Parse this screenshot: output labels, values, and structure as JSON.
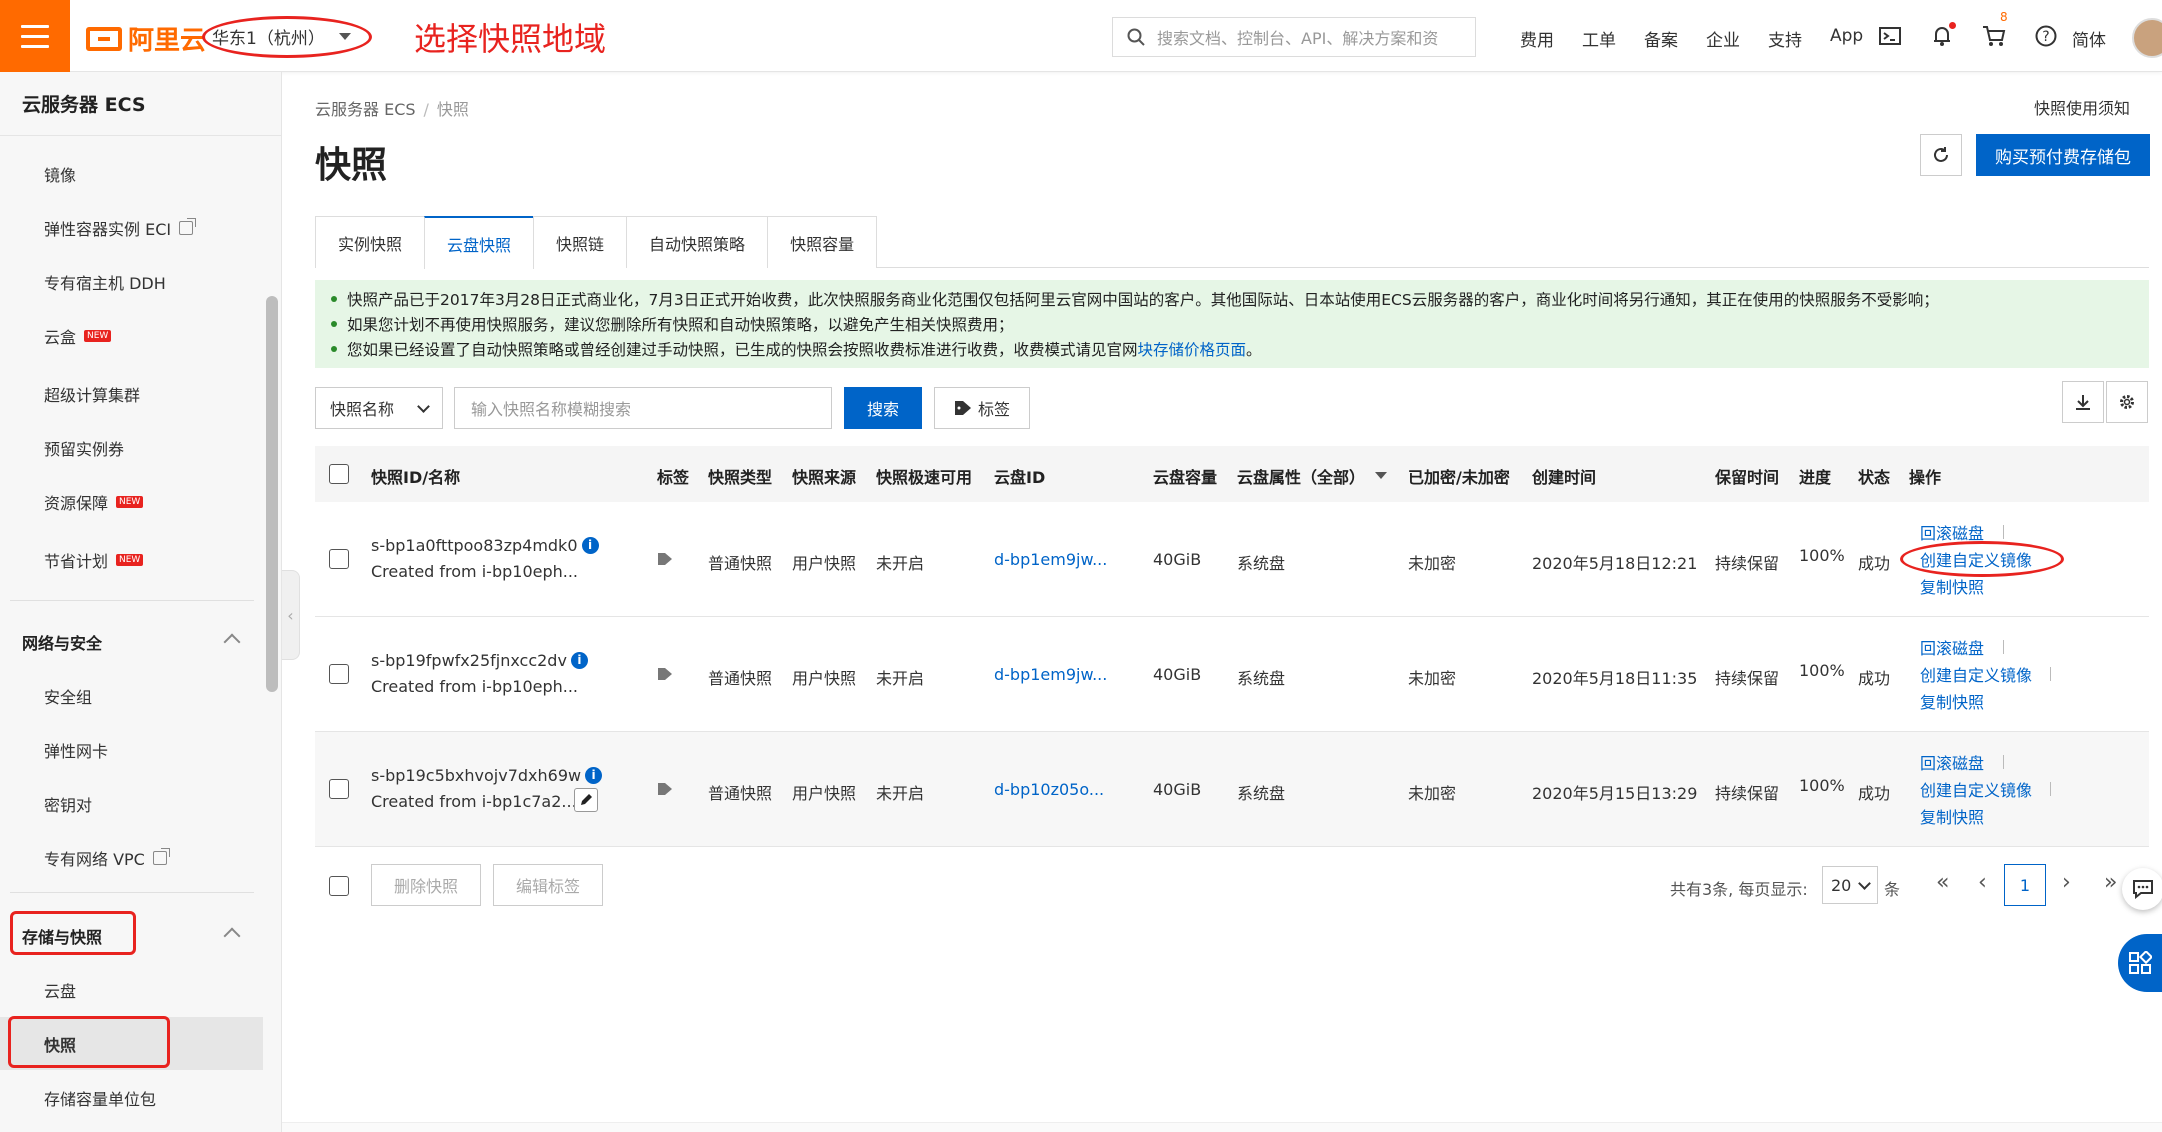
{
  "header": {
    "logo": "阿里云",
    "region": "华东1（杭州）",
    "annotation": "选择快照地域",
    "search_placeholder": "搜索文档、控制台、API、解决方案和资",
    "nav": [
      "费用",
      "工单",
      "备案",
      "企业",
      "支持",
      "App"
    ],
    "cart_count": "8",
    "lang": "简体"
  },
  "sidebar": {
    "title": "云服务器 ECS",
    "items_top": [
      {
        "label": "镜像"
      },
      {
        "label": "弹性容器实例 ECI"
      },
      {
        "label": "专有宿主机 DDH"
      },
      {
        "label": "云盒",
        "badge": "NEW"
      },
      {
        "label": "超级计算集群"
      },
      {
        "label": "预留实例券"
      },
      {
        "label": "资源保障",
        "badge": "NEW"
      },
      {
        "label": "节省计划",
        "badge": "NEW"
      }
    ],
    "group_network": "网络与安全",
    "items_network": [
      "安全组",
      "弹性网卡",
      "密钥对",
      "专有网络 VPC"
    ],
    "group_storage": "存储与快照",
    "items_storage": [
      "云盘",
      "快照",
      "存储容量单位包"
    ]
  },
  "main": {
    "breadcrumb": [
      "云服务器 ECS",
      "快照"
    ],
    "notice_link": "快照使用须知",
    "title": "快照",
    "buy_button": "购买预付费存储包",
    "tabs": [
      "实例快照",
      "云盘快照",
      "快照链",
      "自动快照策略",
      "快照容量"
    ],
    "active_tab": 1,
    "alerts": [
      "快照产品已于2017年3月28日正式商业化，7月3日正式开始收费，此次快照服务商业化范围仅包括阿里云官网中国站的客户。其他国际站、日本站使用ECS云服务器的客户，商业化时间将另行通知，其正在使用的快照服务不受影响；",
      "如果您计划不再使用快照服务，建议您删除所有快照和自动快照策略，以避免产生相关快照费用；",
      "您如果已经设置了自动快照策略或曾经创建过手动快照，已生成的快照会按照收费标准进行收费，收费模式请见官网"
    ],
    "alert_link": "块存储价格页面",
    "alert_tail": "。",
    "filter": {
      "select": "快照名称",
      "placeholder": "输入快照名称模糊搜索",
      "search": "搜索",
      "tag": "标签"
    },
    "table": {
      "headers": [
        "快照ID/名称",
        "标签",
        "快照类型",
        "快照来源",
        "快照极速可用",
        "云盘ID",
        "云盘容量",
        "云盘属性（全部）",
        "已加密/未加密",
        "创建时间",
        "保留时间",
        "进度",
        "状态",
        "操作"
      ],
      "rows": [
        {
          "id": "s-bp1a0fttpoo83zp4mdk0",
          "desc": "Created from i-bp10eph...",
          "type": "普通快照",
          "source": "用户快照",
          "fast": "未开启",
          "disk": "d-bp1em9jw...",
          "size": "40GiB",
          "attr": "系统盘",
          "enc": "未加密",
          "time": "2020年5月18日12:21",
          "keep": "持续保留",
          "progress": "100%",
          "status": "成功"
        },
        {
          "id": "s-bp19fpwfx25fjnxcc2dv",
          "desc": "Created from i-bp10eph...",
          "type": "普通快照",
          "source": "用户快照",
          "fast": "未开启",
          "disk": "d-bp1em9jw...",
          "size": "40GiB",
          "attr": "系统盘",
          "enc": "未加密",
          "time": "2020年5月18日11:35",
          "keep": "持续保留",
          "progress": "100%",
          "status": "成功"
        },
        {
          "id": "s-bp19c5bxhvojv7dxh69w",
          "desc": "Created from i-bp1c7a2...",
          "type": "普通快照",
          "source": "用户快照",
          "fast": "未开启",
          "disk": "d-bp10z05o...",
          "size": "40GiB",
          "attr": "系统盘",
          "enc": "未加密",
          "time": "2020年5月15日13:29",
          "keep": "持续保留",
          "progress": "100%",
          "status": "成功"
        }
      ],
      "ops": [
        "回滚磁盘",
        "创建自定义镜像",
        "复制快照"
      ]
    },
    "footer": {
      "delete": "删除快照",
      "edit_tags": "编辑标签",
      "total": "共有3条, 每页显示:",
      "page_size": "20",
      "unit": "条",
      "page": "1"
    }
  }
}
